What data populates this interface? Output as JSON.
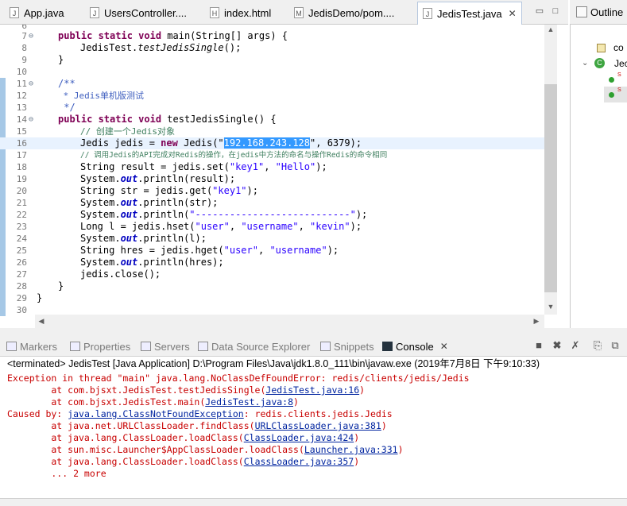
{
  "editor_tabs": [
    {
      "label": "App.java",
      "icon": "java-file-icon"
    },
    {
      "label": "UsersController....",
      "icon": "java-file-icon"
    },
    {
      "label": "index.html",
      "icon": "html-file-icon"
    },
    {
      "label": "JedisDemo/pom....",
      "icon": "maven-pom-icon"
    },
    {
      "label": "JedisTest.java",
      "icon": "java-file-icon",
      "active": true
    }
  ],
  "outline": {
    "title": "Outline",
    "item1": "co",
    "item2": "Jec"
  },
  "code": {
    "l6": "6",
    "l7": "7",
    "l7_kw": "public static void ",
    "l7_rest": "main(String[] args) {",
    "l8": "8",
    "l8_pre": "JedisTest.",
    "l8_it": "testJedisSingle",
    "l8_post": "();",
    "l9": "9",
    "l9_code": "}",
    "l10": "10",
    "l11": "11",
    "l11_code": "/**",
    "l12": "12",
    "l12_code": " * Jedis单机版测试",
    "l13": "13",
    "l13_code": " */",
    "l14": "14",
    "l14_kw": "public static void ",
    "l14_rest": "testJedisSingle() {",
    "l15": "15",
    "l15_code": "// 创建一个Jedis对象",
    "l16": "16",
    "l16_pre": "Jedis jedis = ",
    "l16_kw": "new",
    "l16_mid": " Jedis(\"",
    "l16_sel": "192.168.243.128",
    "l16_post": "\", 6379);",
    "l17": "17",
    "l17_code": "// 调用Jedis的API完成对Redis的操作，在jedis中方法的命名与操作Redis的命令相同",
    "l18": "18",
    "l18_pre": "String result = jedis.set(",
    "l18_s1": "\"key1\"",
    "l18_c": ", ",
    "l18_s2": "\"Hello\"",
    "l18_post": ");",
    "l19": "19",
    "l19_pre": "System.",
    "l19_f": "out",
    "l19_post": ".println(result);",
    "l20": "20",
    "l20_pre": "String str = jedis.get(",
    "l20_s": "\"key1\"",
    "l20_post": ");",
    "l21": "21",
    "l21_pre": "System.",
    "l21_f": "out",
    "l21_post": ".println(str);",
    "l22": "22",
    "l22_pre": "System.",
    "l22_f": "out",
    "l22_mid": ".println(",
    "l22_s": "\"---------------------------\"",
    "l22_post": ");",
    "l23": "23",
    "l23_pre": "Long l = jedis.hset(",
    "l23_s1": "\"user\"",
    "l23_c1": ", ",
    "l23_s2": "\"username\"",
    "l23_c2": ", ",
    "l23_s3": "\"kevin\"",
    "l23_post": ");",
    "l24": "24",
    "l24_pre": "System.",
    "l24_f": "out",
    "l24_post": ".println(l);",
    "l25": "25",
    "l25_pre": "String hres = jedis.hget(",
    "l25_s1": "\"user\"",
    "l25_c": ", ",
    "l25_s2": "\"username\"",
    "l25_post": ");",
    "l26": "26",
    "l26_pre": "System.",
    "l26_f": "out",
    "l26_post": ".println(hres);",
    "l27": "27",
    "l27_code": "jedis.close();",
    "l28": "28",
    "l28_code": "}",
    "l29": "29",
    "l29_code": "}",
    "l30": "30"
  },
  "console_tabs": [
    {
      "label": "Markers"
    },
    {
      "label": "Properties"
    },
    {
      "label": "Servers"
    },
    {
      "label": "Data Source Explorer"
    },
    {
      "label": "Snippets"
    },
    {
      "label": "Console",
      "active": true
    }
  ],
  "terminated_line": "<terminated> JedisTest [Java Application] D:\\Program Files\\Java\\jdk1.8.0_111\\bin\\javaw.exe (2019年7月8日 下午9:10:33)",
  "console": {
    "c1": "Exception in thread \"main\" java.lang.NoClassDefFoundError: redis/clients/jedis/Jedis",
    "c2_pre": "        at com.bjsxt.JedisTest.testJedisSingle(",
    "c2_link": "JedisTest.java:16",
    "c2_post": ")",
    "c3_pre": "        at com.bjsxt.JedisTest.main(",
    "c3_link": "JedisTest.java:8",
    "c3_post": ")",
    "c4_pre": "Caused by: ",
    "c4_link": "java.lang.ClassNotFoundException",
    "c4_post": ": redis.clients.jedis.Jedis",
    "c5_pre": "        at java.net.URLClassLoader.findClass(",
    "c5_link": "URLClassLoader.java:381",
    "c5_post": ")",
    "c6_pre": "        at java.lang.ClassLoader.loadClass(",
    "c6_link": "ClassLoader.java:424",
    "c6_post": ")",
    "c7_pre": "        at sun.misc.Launcher$AppClassLoader.loadClass(",
    "c7_link": "Launcher.java:331",
    "c7_post": ")",
    "c8_pre": "        at java.lang.ClassLoader.loadClass(",
    "c8_link": "ClassLoader.java:357",
    "c8_post": ")",
    "c9": "        ... 2 more"
  },
  "colors": {
    "keyword": "#7f0055",
    "string": "#2a00ff",
    "comment": "#3f7f5f",
    "error": "#c80000",
    "link": "#00249f",
    "selection": "#3399ff"
  }
}
